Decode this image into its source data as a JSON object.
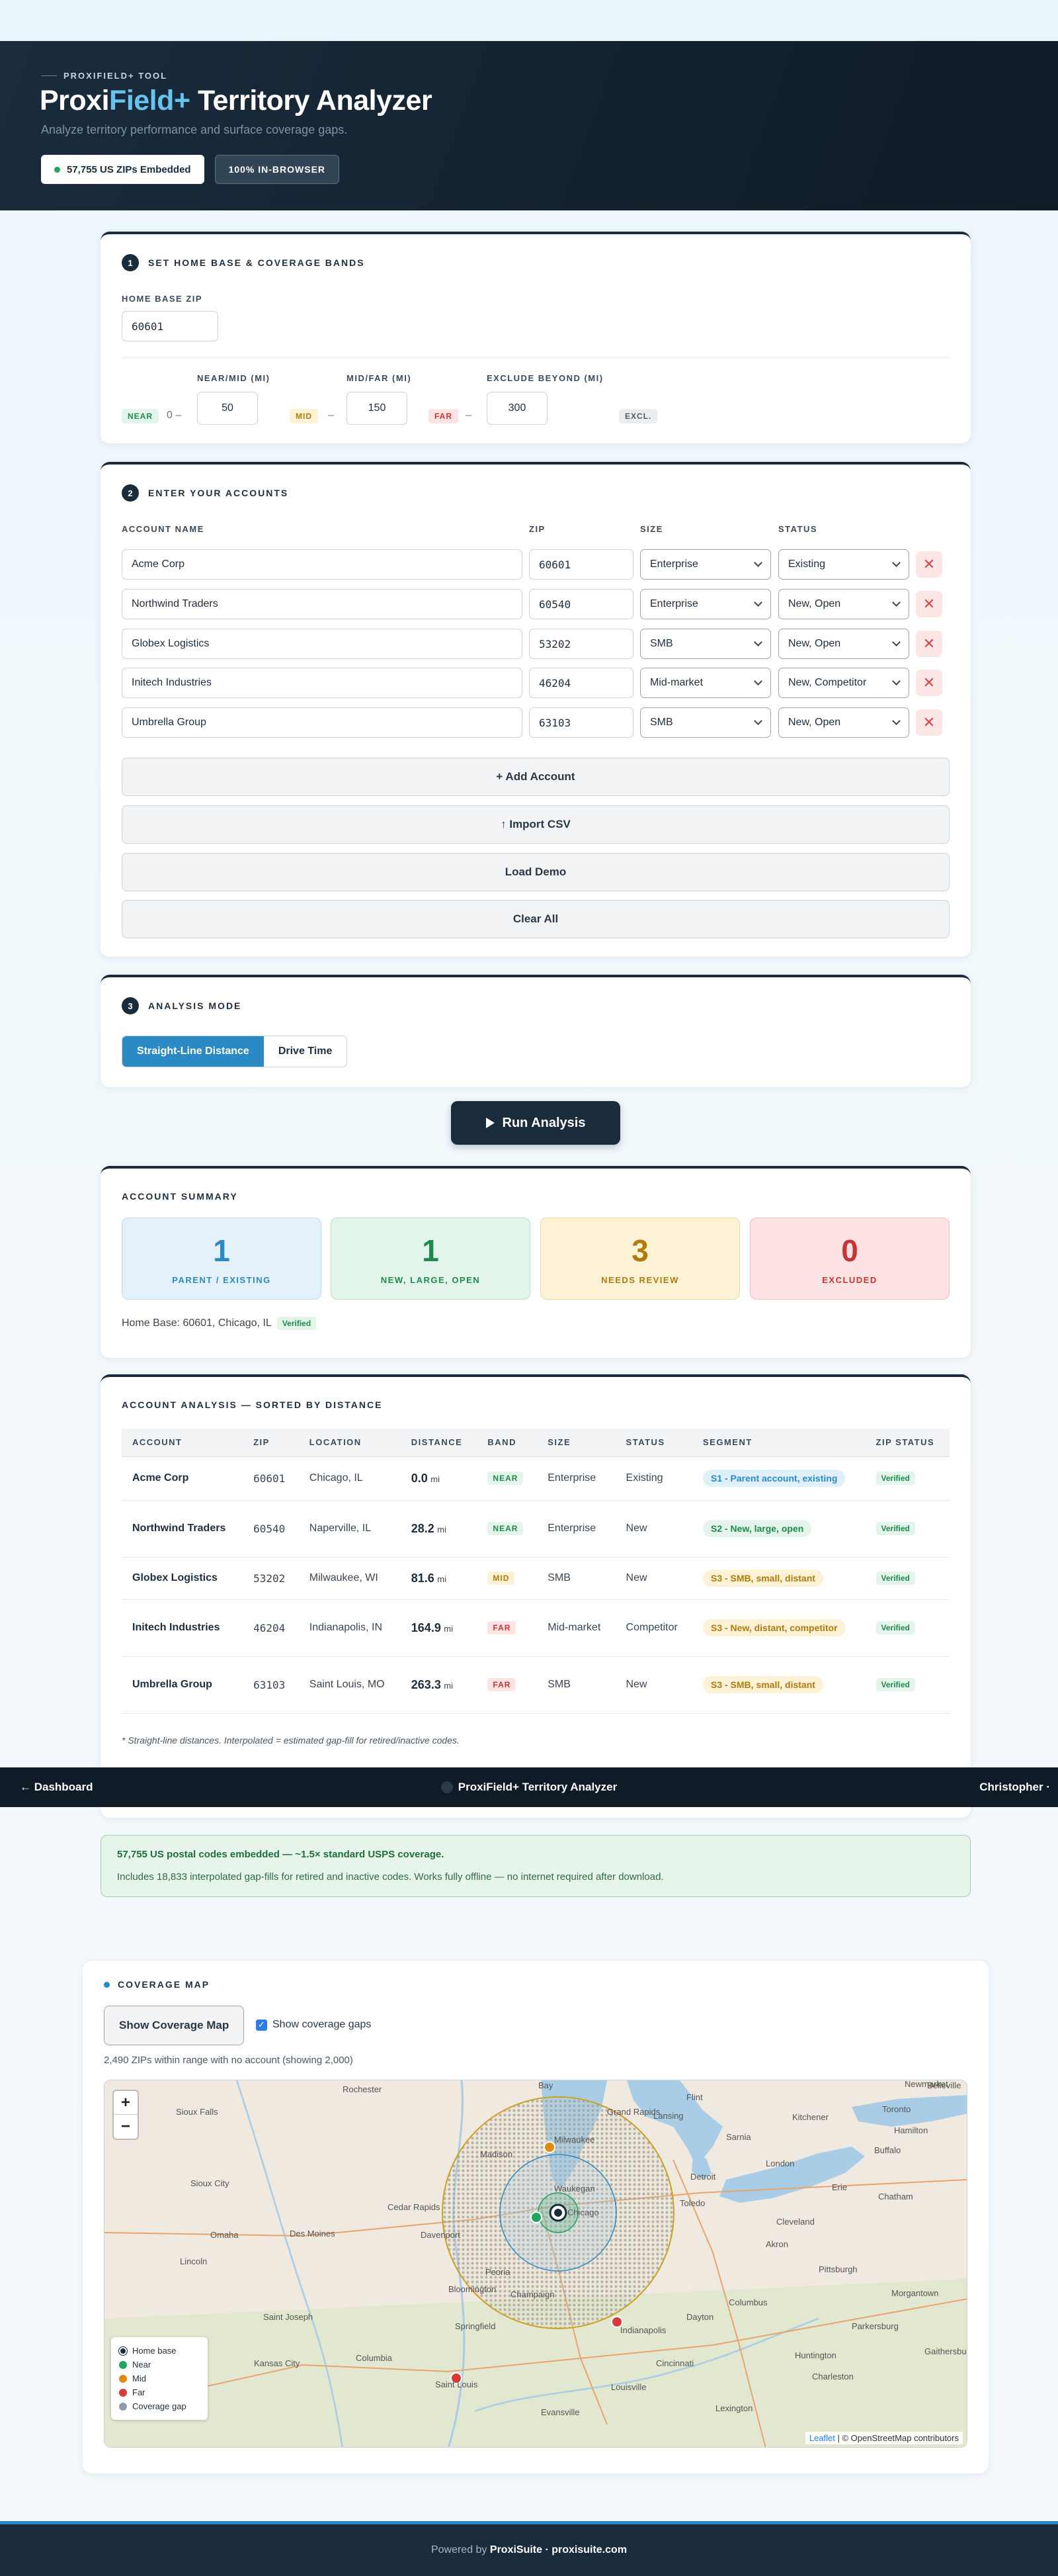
{
  "hero": {
    "eyebrow": "PROXIFIELD+ TOOL",
    "title_a": "Proxi",
    "title_b": "Field+",
    "title_c": " Territory Analyzer",
    "subtitle": "Analyze territory performance and surface coverage gaps.",
    "badge_zips": "57,755 US ZIPs Embedded",
    "badge_browser": "100% IN-BROWSER"
  },
  "step1": {
    "num": "1",
    "title": "SET HOME BASE & COVERAGE BANDS",
    "home_label": "HOME BASE ZIP",
    "home_value": "60601",
    "near_label": "NEAR/MID (MI)",
    "near_value": "50",
    "mid_label": "MID/FAR (MI)",
    "mid_value": "150",
    "excl_label": "EXCLUDE BEYOND (MI)",
    "excl_value": "300",
    "chip_near": "NEAR",
    "chip_mid": "MID",
    "chip_far": "FAR",
    "chip_excl": "EXCL.",
    "zero": "0 –",
    "dash": "–"
  },
  "step2": {
    "num": "2",
    "title": "ENTER YOUR ACCOUNTS",
    "col_name": "ACCOUNT NAME",
    "col_zip": "ZIP",
    "col_size": "SIZE",
    "col_status": "STATUS",
    "delete_glyph": "✕",
    "accounts": [
      {
        "name": "Acme Corp",
        "zip": "60601",
        "size": "Enterprise",
        "status": "Existing"
      },
      {
        "name": "Northwind Traders",
        "zip": "60540",
        "size": "Enterprise",
        "status": "New, Open"
      },
      {
        "name": "Globex Logistics",
        "zip": "53202",
        "size": "SMB",
        "status": "New, Open"
      },
      {
        "name": "Initech Industries",
        "zip": "46204",
        "size": "Mid-market",
        "status": "New, Competitor"
      },
      {
        "name": "Umbrella Group",
        "zip": "63103",
        "size": "SMB",
        "status": "New, Open"
      }
    ],
    "add": "+ Add Account",
    "import": "↑ Import CSV",
    "demo": "Load Demo",
    "clear": "Clear All"
  },
  "step3": {
    "num": "3",
    "title": "ANALYSIS MODE",
    "mode_straight": "Straight-Line Distance",
    "mode_drive": "Drive Time"
  },
  "run_label": "Run Analysis",
  "summary": {
    "title": "ACCOUNT SUMMARY",
    "stats": [
      {
        "num": "1",
        "label": "PARENT / EXISTING"
      },
      {
        "num": "1",
        "label": "NEW, LARGE, OPEN"
      },
      {
        "num": "3",
        "label": "NEEDS REVIEW"
      },
      {
        "num": "0",
        "label": "EXCLUDED"
      }
    ],
    "home_text": "Home Base: 60601, Chicago, IL",
    "verified": "Verified"
  },
  "analysis": {
    "title": "ACCOUNT ANALYSIS — SORTED BY DISTANCE",
    "headers": [
      "ACCOUNT",
      "ZIP",
      "LOCATION",
      "DISTANCE",
      "BAND",
      "SIZE",
      "STATUS",
      "SEGMENT",
      "ZIP STATUS"
    ],
    "unit": "mi",
    "rows": [
      {
        "account": "Acme Corp",
        "zip": "60601",
        "location": "Chicago, IL",
        "distance": "0.0",
        "band": "NEAR",
        "size": "Enterprise",
        "status": "Existing",
        "segment": "S1 - Parent account, existing",
        "zip_status": "Verified"
      },
      {
        "account": "Northwind Traders",
        "zip": "60540",
        "location": "Naperville, IL",
        "distance": "28.2",
        "band": "NEAR",
        "size": "Enterprise",
        "status": "New",
        "segment": "S2 - New, large, open",
        "zip_status": "Verified"
      },
      {
        "account": "Globex Logistics",
        "zip": "53202",
        "location": "Milwaukee, WI",
        "distance": "81.6",
        "band": "MID",
        "size": "SMB",
        "status": "New",
        "segment": "S3 - SMB, small, distant",
        "zip_status": "Verified"
      },
      {
        "account": "Initech Industries",
        "zip": "46204",
        "location": "Indianapolis, IN",
        "distance": "164.9",
        "band": "FAR",
        "size": "Mid-market",
        "status": "Competitor",
        "segment": "S3 - New, distant, competitor",
        "zip_status": "Verified"
      },
      {
        "account": "Umbrella Group",
        "zip": "63103",
        "location": "Saint Louis, MO",
        "distance": "263.3",
        "band": "FAR",
        "size": "SMB",
        "status": "New",
        "segment": "S3 - SMB, small, distant",
        "zip_status": "Verified"
      }
    ],
    "footnote": "* Straight-line distances. Interpolated = estimated gap-fill for retired/inactive codes."
  },
  "navbar": {
    "back": "← Dashboard",
    "title": "ProxiField+ Territory Analyzer",
    "user": "Christopher ·"
  },
  "info": {
    "title": "57,755 US postal codes embedded — ~1.5× standard USPS coverage.",
    "body": "Includes 18,833 interpolated gap-fills for retired and inactive codes. Works fully offline — no internet required after download."
  },
  "map_section": {
    "title": "COVERAGE MAP",
    "show_btn": "Show Coverage Map",
    "gaps_label": "Show coverage gaps",
    "gaps_checked": true,
    "gap_note": "2,490 ZIPs within range with no account (showing 2,000)",
    "zoom_in": "+",
    "zoom_out": "−",
    "legend": [
      {
        "label": "Home base",
        "color": "#1a2b3c"
      },
      {
        "label": "Near",
        "color": "#22a55e"
      },
      {
        "label": "Mid",
        "color": "#e08a10"
      },
      {
        "label": "Far",
        "color": "#d63a3a"
      },
      {
        "label": "Coverage gap",
        "color": "#8f9bb0"
      }
    ],
    "attribution_leaflet": "Leaflet",
    "attribution_rest": " | © OpenStreetMap contributors",
    "places": [
      "Bay",
      "Rochester",
      "Sioux Falls",
      "Sioux City",
      "Omaha",
      "Lincoln",
      "Des Moines",
      "Cedar Rapids",
      "Davenport",
      "Madison",
      "Milwaukee",
      "Waukegan",
      "Chicago",
      "Peoria",
      "Bloomington",
      "Champaign",
      "Springfield",
      "Saint Joseph",
      "Kansas City",
      "Columbia",
      "Saint Louis",
      "Evansville",
      "Louisville",
      "Indianapolis",
      "Cincinnati",
      "Dayton",
      "Columbus",
      "Toledo",
      "Detroit",
      "London",
      "Hamilton",
      "Toronto",
      "Buffalo",
      "Erie",
      "Cleveland",
      "Akron",
      "Pittsburgh",
      "Lansing",
      "Flint",
      "Grand Rapids",
      "Sarnia",
      "Kitchener",
      "Newmarket",
      "Belleville",
      "Morgantown",
      "Charleston",
      "Lexington",
      "Chatham",
      "Gaithersburg",
      "Huntington",
      "Parkersburg"
    ]
  },
  "footer": {
    "prefix": "Powered by ",
    "brand": "ProxiSuite · proxisuite.com"
  }
}
